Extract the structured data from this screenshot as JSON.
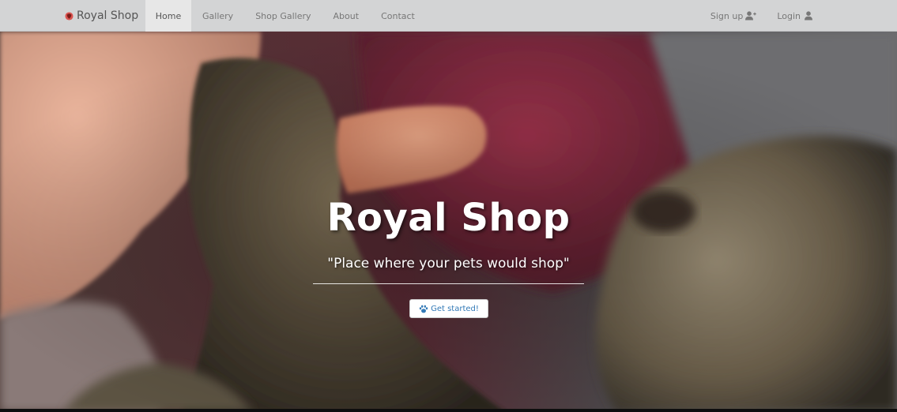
{
  "navbar": {
    "brand": {
      "label": "Royal Shop",
      "icon": "shield-icon",
      "icon_color": "#d9534f"
    },
    "links": [
      {
        "label": "Home",
        "active": true
      },
      {
        "label": "Gallery",
        "active": false
      },
      {
        "label": "Shop Gallery",
        "active": false
      },
      {
        "label": "About",
        "active": false
      },
      {
        "label": "Contact",
        "active": false
      }
    ],
    "right": [
      {
        "label": "Sign up",
        "icon": "user-plus-icon"
      },
      {
        "label": "Login",
        "icon": "user-icon"
      }
    ],
    "background": "#d3d4d5"
  },
  "hero": {
    "title": "Royal Shop",
    "subtitle": "\"Place where your pets would shop\"",
    "cta": {
      "label": "Get started!",
      "icon": "paw-icon",
      "color": "#337ab7"
    },
    "background_image": "photo of a cat's paw touching a human hand"
  }
}
